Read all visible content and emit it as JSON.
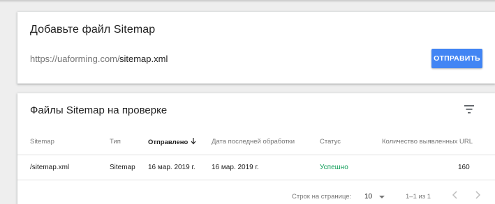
{
  "add_card": {
    "title": "Добавьте файл Sitemap",
    "url_prefix": "https://uaforming.com/",
    "input_value": "sitemap.xml",
    "submit_label": "ОТПРАВИТЬ"
  },
  "list_card": {
    "title": "Файлы Sitemap на проверке",
    "filter_icon": "filter-list-icon",
    "columns": {
      "sitemap": "Sitemap",
      "type": "Тип",
      "submitted": "Отправлено",
      "last_read": "Дата последней обработки",
      "status": "Статус",
      "urls": "Количество выявленных URL"
    },
    "sorted_by": "submitted",
    "rows": [
      {
        "sitemap": "/sitemap.xml",
        "type": "Sitemap",
        "submitted": "16 мар. 2019 г.",
        "last_read": "16 мар. 2019 г.",
        "status": "Успешно",
        "urls": "160"
      }
    ],
    "pagination": {
      "rows_per_page_label": "Строк на странице:",
      "rows_per_page": "10",
      "range": "1–1 из 1",
      "prev_icon": "chevron-left-icon",
      "next_icon": "chevron-right-icon"
    }
  },
  "colors": {
    "accent": "#4285f4",
    "status_success": "#0f9d58",
    "background": "#eeeeee"
  }
}
